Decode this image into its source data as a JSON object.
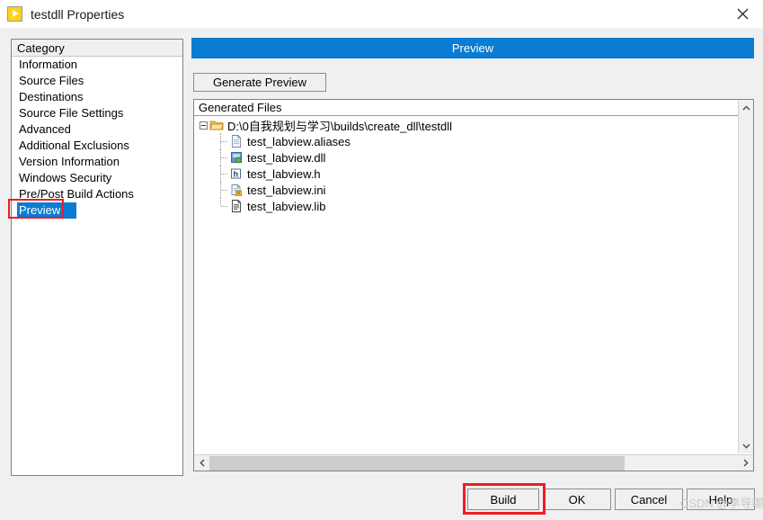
{
  "window": {
    "title": "testdll Properties",
    "app_icon": "labview-vi-icon",
    "close_icon": "close-icon"
  },
  "category_panel": {
    "header": "Category",
    "items": [
      {
        "label": "Information",
        "selected": false
      },
      {
        "label": "Source Files",
        "selected": false
      },
      {
        "label": "Destinations",
        "selected": false
      },
      {
        "label": "Source File Settings",
        "selected": false
      },
      {
        "label": "Advanced",
        "selected": false
      },
      {
        "label": "Additional Exclusions",
        "selected": false
      },
      {
        "label": "Version Information",
        "selected": false
      },
      {
        "label": "Windows Security",
        "selected": false
      },
      {
        "label": "Pre/Post Build Actions",
        "selected": false
      },
      {
        "label": "Preview",
        "selected": true
      }
    ]
  },
  "main": {
    "header_title": "Preview",
    "generate_button": "Generate Preview",
    "tree_header": "Generated Files",
    "root": {
      "label": "D:\\0自我规划与学习\\builds\\create_dll\\testdll",
      "icon": "folder-icon",
      "expanded": true
    },
    "files": [
      {
        "label": "test_labview.aliases",
        "icon": "file-aliases-icon"
      },
      {
        "label": "test_labview.dll",
        "icon": "file-dll-icon"
      },
      {
        "label": "test_labview.h",
        "icon": "file-header-icon"
      },
      {
        "label": "test_labview.ini",
        "icon": "file-ini-icon"
      },
      {
        "label": "test_labview.lib",
        "icon": "file-lib-icon"
      }
    ]
  },
  "scrollbars": {
    "vertical": {
      "up_icon": "chevron-up-icon",
      "down_icon": "chevron-down-icon"
    },
    "horizontal": {
      "left_icon": "chevron-left-icon",
      "right_icon": "chevron-right-icon",
      "thumb_percent": 75
    }
  },
  "footer": {
    "buttons": [
      {
        "label": "Build"
      },
      {
        "label": "OK"
      },
      {
        "label": "Cancel"
      },
      {
        "label": "Help"
      }
    ]
  },
  "watermark": "CSDN @李导哪",
  "colors": {
    "accent_blue": "#0a7cd2",
    "annotation_red": "#ee1c24",
    "dialog_bg": "#f0f0f0",
    "panel_bg": "#ffffff"
  }
}
